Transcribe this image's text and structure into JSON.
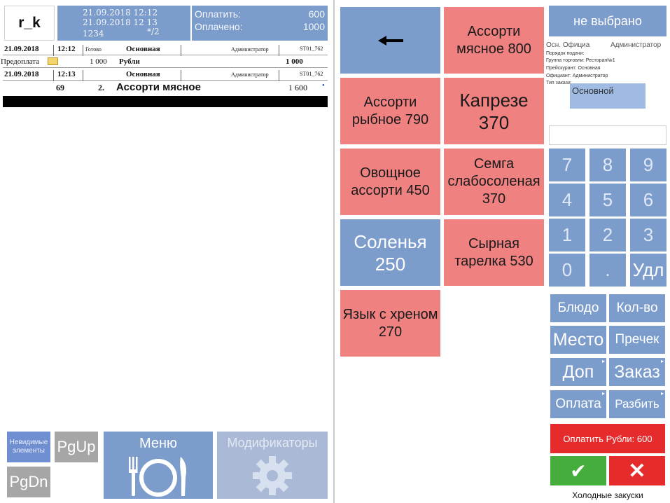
{
  "header": {
    "logo": "r_k",
    "order": {
      "opened": "21.09.2018 12:12",
      "printed": "21.09.2018 12 13",
      "number": "1234",
      "guests": "*/2"
    },
    "payment": {
      "to_pay_label": "Оплатить:",
      "to_pay_value": "600",
      "paid_label": "Оплачено:",
      "paid_value": "1000"
    }
  },
  "order_lines": [
    {
      "date": "21.09.2018",
      "time": "12:12",
      "status": "Готово",
      "menu": "Основная",
      "waiter": "Администратор",
      "station": "ST01_762"
    },
    {
      "label": "Предоплата",
      "amount": "1 000",
      "currency": "Рубли",
      "total": "1 000"
    },
    {
      "date": "21.09.2018",
      "time": "12:13",
      "menu": "Основная",
      "waiter": "Администратор",
      "station": "ST01_762"
    },
    {
      "code": "69",
      "index": "2.",
      "name": "Ассорти мясное",
      "price": "1 600",
      "marker": "•"
    }
  ],
  "left_buttons": {
    "invisible": "Невидимые элементы",
    "pgup": "PgUp",
    "pgdn": "PgDn",
    "menu": "Меню",
    "modifiers": "Модификаторы"
  },
  "grid": {
    "back_arrow": "←",
    "items": [
      {
        "name": "Ассорти мясное 800",
        "color": "#ef8181"
      },
      {
        "name": "Ассорти рыбное 790",
        "color": "#ef8181"
      },
      {
        "name": "Капрезе 370",
        "color": "#ef8181"
      },
      {
        "name": "Овощное ассорти 450",
        "color": "#ef8181"
      },
      {
        "name": "Семга слабосоленая 370",
        "color": "#ef8181"
      },
      {
        "name": "Соленья 250",
        "color": "#7c9ccb"
      },
      {
        "name": "Сырная тарелка 530",
        "color": "#ef8181"
      },
      {
        "name": "Язык с хреном 270",
        "color": "#ef8181"
      }
    ]
  },
  "right": {
    "not_chosen": "не выбрано",
    "info": {
      "waiter_label": "Осн. Официа",
      "waiter_value": "Администратор",
      "line2": "Порядок подачи:",
      "line3": "Группа торговли: Ресторан№1",
      "line4": "Прейскурант: Основная",
      "line5": "Официант: Администратор",
      "line6": "Тип заказа:",
      "menu_badge": "Основной"
    },
    "keypad": [
      "7",
      "8",
      "9",
      "4",
      "5",
      "6",
      "1",
      "2",
      "3",
      "0",
      ".",
      "Удл"
    ],
    "actions": {
      "dish": "Блюдо",
      "qty": "Кол-во",
      "seat": "Место",
      "precheck": "Пречек",
      "extra": "Доп",
      "order": "Заказ",
      "payment": "Оплата",
      "split": "Разбить"
    },
    "pay_button": "Оплатить Рубли: 600",
    "ok": "✔",
    "cancel": "✕",
    "category": "Холодные закуски"
  },
  "colors": {
    "blue": "#7c9ccb",
    "pink": "#ef8181",
    "red": "#e52b2b",
    "green": "#45ad3b"
  }
}
